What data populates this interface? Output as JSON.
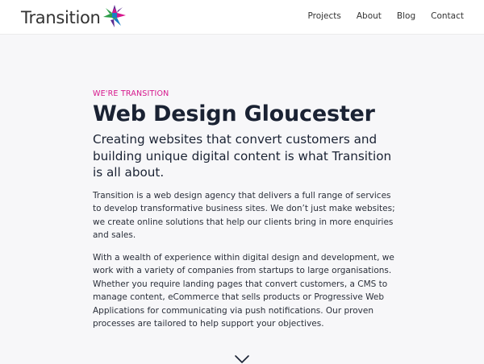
{
  "header": {
    "logo_text": "Transition",
    "nav": [
      "Projects",
      "About",
      "Blog",
      "Contact"
    ]
  },
  "main": {
    "eyebrow": "WE'RE TRANSITION",
    "title": "Web Design Gloucester",
    "lead": "Creating websites that convert customers and building unique digital content is what Transition is all about.",
    "paragraphs": [
      "Transition is a web design agency that delivers a full range of services to develop transformative business sites. We don’t just make websites; we create online solutions that help our clients bring in more enquiries and sales.",
      "With a wealth of experience within digital design and development, we work with a variety of companies from startups to large organisations. Whether you require landing pages that convert customers, a CMS to manage content, eCommerce that sells products or Progressive Web Applications for communicating via push notifications. Our proven processes are tailored to help support your objectives."
    ]
  },
  "icons": {
    "logo_mark": "transition-star-logo",
    "scroll": "chevron-down-icon"
  },
  "colors": {
    "accent": "#d6168c",
    "heading": "#1a2233",
    "background": "#f7f7f9",
    "logo_green": "#2e9e4a",
    "logo_purple": "#5a2d91",
    "logo_pink": "#d6168c",
    "logo_blue": "#1b7fc4"
  }
}
